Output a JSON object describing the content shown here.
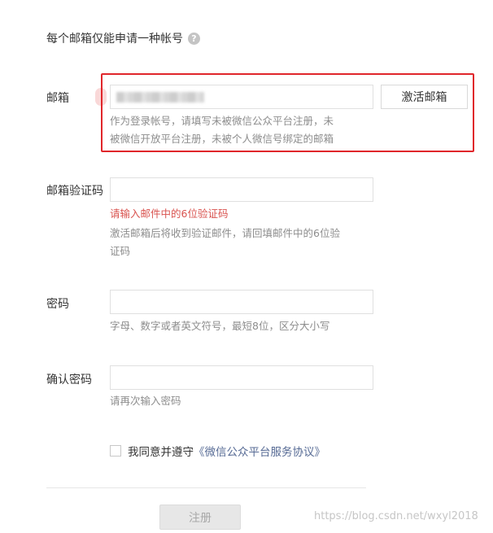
{
  "notice": "每个邮箱仅能申请一种帐号",
  "email": {
    "label": "邮箱",
    "activate_button": "激活邮箱",
    "hint_line1": "作为登录帐号，请填写未被微信公众平台注册，未",
    "hint_line2": "被微信开放平台注册，未被个人微信号绑定的邮箱"
  },
  "code": {
    "label": "邮箱验证码",
    "error": "请输入邮件中的6位验证码",
    "hint_line1": "激活邮箱后将收到验证邮件，请回填邮件中的6位验",
    "hint_line2": "证码"
  },
  "password": {
    "label": "密码",
    "hint": "字母、数字或者英文符号，最短8位，区分大小写"
  },
  "confirm": {
    "label": "确认密码",
    "hint": "请再次输入密码"
  },
  "agreement": {
    "text": "我同意并遵守",
    "link": "《微信公众平台服务协议》"
  },
  "submit_label": "注册",
  "watermark": "https://blog.csdn.net/wxyl2018",
  "colors": {
    "highlight": "#e0262b",
    "error": "#d9534f",
    "link": "#576b95"
  },
  "icons": {
    "help": "question-circle-icon"
  }
}
